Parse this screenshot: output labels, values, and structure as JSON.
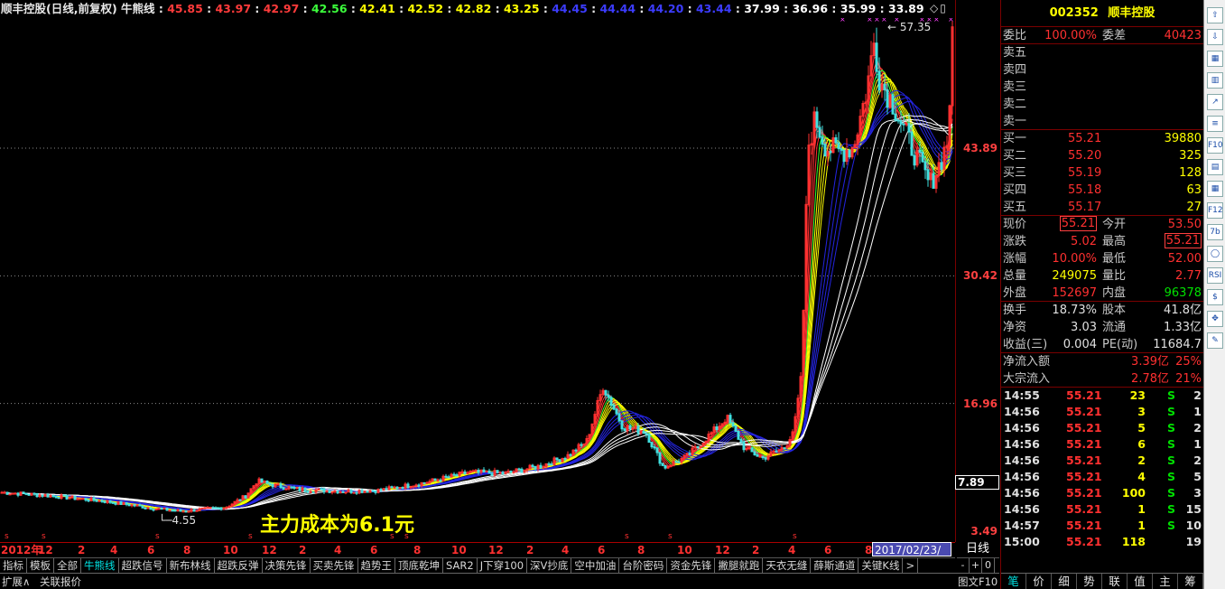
{
  "title": {
    "name": "顺丰控股(日线,前复权) 牛熊线",
    "values": [
      {
        "v": "45.85",
        "c": "#ff3b3b"
      },
      {
        "v": "43.97",
        "c": "#ff3b3b"
      },
      {
        "v": "42.97",
        "c": "#ff3b3b"
      },
      {
        "v": "42.56",
        "c": "#3cff3c"
      },
      {
        "v": "42.41",
        "c": "#ffff00"
      },
      {
        "v": "42.52",
        "c": "#ffff00"
      },
      {
        "v": "42.82",
        "c": "#ffff00"
      },
      {
        "v": "43.25",
        "c": "#ffff00"
      },
      {
        "v": "44.45",
        "c": "#3c3cff"
      },
      {
        "v": "44.44",
        "c": "#3c3cff"
      },
      {
        "v": "44.20",
        "c": "#3c3cff"
      },
      {
        "v": "43.44",
        "c": "#3c3cff"
      },
      {
        "v": "37.99",
        "c": "#ffffff"
      },
      {
        "v": "36.96",
        "c": "#ffffff"
      },
      {
        "v": "35.99",
        "c": "#ffffff"
      },
      {
        "v": "33.89",
        "c": "#ffffff"
      }
    ]
  },
  "chart": {
    "y_labels": [
      "43.89",
      "30.42",
      "16.96",
      "3.49"
    ],
    "current_price_label": "7.89",
    "high_marker": "57.35",
    "low_marker": "4.55",
    "annotation": "主力成本为6.1元",
    "x_ticks": [
      "2012年",
      "12",
      "2",
      "4",
      "6",
      "8",
      "10",
      "12",
      "2",
      "4",
      "6",
      "8",
      "10",
      "12",
      "2",
      "4",
      "6",
      "8",
      "10",
      "12",
      "2",
      "4",
      "6",
      "8",
      "1"
    ],
    "cursor_date": "2017/02/23/四",
    "period": "日线"
  },
  "tabs": [
    "指标",
    "模板",
    "全部",
    "牛熊线",
    "超跌信号",
    "新布林线",
    "超跌反弹",
    "决策先锋",
    "买卖先锋",
    "趋势王",
    "顶底乾坤",
    "SAR2",
    "J下穿100",
    "深V抄底",
    "空中加油",
    "台阶密码",
    "资金先锋",
    "撇腿就跑",
    "天衣无缝",
    "薛斯通道",
    "关键K线",
    ">"
  ],
  "active_tab": "牛熊线",
  "tab_nav": [
    "-",
    "+",
    "0"
  ],
  "status": {
    "expand": "扩展∧",
    "quote": "关联报价",
    "figure": "图文F10"
  },
  "quote": {
    "code": "002352",
    "name": "顺丰控股",
    "weibi_label": "委比",
    "weibi": "100.00%",
    "weicha_label": "委差",
    "weicha": "40423",
    "asks": [
      {
        "label": "卖五"
      },
      {
        "label": "卖四"
      },
      {
        "label": "卖三"
      },
      {
        "label": "卖二"
      },
      {
        "label": "卖一"
      }
    ],
    "bids": [
      {
        "label": "买一",
        "price": "55.21",
        "vol": "39880"
      },
      {
        "label": "买二",
        "price": "55.20",
        "vol": "325"
      },
      {
        "label": "买三",
        "price": "55.19",
        "vol": "128"
      },
      {
        "label": "买四",
        "price": "55.18",
        "vol": "63"
      },
      {
        "label": "买五",
        "price": "55.17",
        "vol": "27"
      }
    ],
    "stats": [
      {
        "l1": "现价",
        "v1": "55.21",
        "l2": "今开",
        "v2": "53.50",
        "c1": "red",
        "c2": "red",
        "box1": true
      },
      {
        "l1": "涨跌",
        "v1": "5.02",
        "l2": "最高",
        "v2": "55.21",
        "c1": "red",
        "c2": "red",
        "box2": true
      },
      {
        "l1": "涨幅",
        "v1": "10.00%",
        "l2": "最低",
        "v2": "52.00",
        "c1": "red",
        "c2": "red"
      },
      {
        "l1": "总量",
        "v1": "249075",
        "l2": "量比",
        "v2": "2.77",
        "c1": "yellow",
        "c2": "red"
      },
      {
        "l1": "外盘",
        "v1": "152697",
        "l2": "内盘",
        "v2": "96378",
        "c1": "red",
        "c2": "green"
      }
    ],
    "info": [
      {
        "l1": "换手",
        "v1": "18.73%",
        "l2": "股本",
        "v2": "41.8亿"
      },
      {
        "l1": "净资",
        "v1": "3.03",
        "l2": "流通",
        "v2": "1.33亿"
      },
      {
        "l1": "收益(三)",
        "v1": "0.004",
        "l2": "PE(动)",
        "v2": "11684.7"
      }
    ],
    "flows": [
      {
        "label": "净流入额",
        "v1": "3.39亿",
        "v2": "25%"
      },
      {
        "label": "大宗流入",
        "v1": "2.78亿",
        "v2": "21%"
      }
    ],
    "ticks": [
      {
        "t": "14:55",
        "p": "55.21",
        "v": "23",
        "s": "S",
        "n": "2"
      },
      {
        "t": "14:56",
        "p": "55.21",
        "v": "3",
        "s": "S",
        "n": "1"
      },
      {
        "t": "14:56",
        "p": "55.21",
        "v": "5",
        "s": "S",
        "n": "2"
      },
      {
        "t": "14:56",
        "p": "55.21",
        "v": "6",
        "s": "S",
        "n": "1"
      },
      {
        "t": "14:56",
        "p": "55.21",
        "v": "2",
        "s": "S",
        "n": "2"
      },
      {
        "t": "14:56",
        "p": "55.21",
        "v": "4",
        "s": "S",
        "n": "5"
      },
      {
        "t": "14:56",
        "p": "55.21",
        "v": "100",
        "s": "S",
        "n": "3"
      },
      {
        "t": "14:56",
        "p": "55.21",
        "v": "1",
        "s": "S",
        "n": "15"
      },
      {
        "t": "14:57",
        "p": "55.21",
        "v": "1",
        "s": "S",
        "n": "10"
      },
      {
        "t": "15:00",
        "p": "55.21",
        "v": "118",
        "s": "",
        "n": "19"
      }
    ],
    "bottom_tabs": [
      "笔",
      "价",
      "细",
      "势",
      "联",
      "值",
      "主",
      "筹"
    ]
  },
  "toolbar_icons": [
    "arrow-up-icon",
    "arrow-down-icon",
    "chart-grid-icon",
    "candlestick-icon",
    "line-chart-icon",
    "k-line-icon",
    "f10-icon",
    "f8-icon",
    "table-icon",
    "f12-icon",
    "f7-icon",
    "circle-icon",
    "rss-icon",
    "money-icon",
    "move-icon",
    "pencil-icon"
  ],
  "toolbar_labels": [
    "",
    "",
    "",
    "",
    "",
    "",
    "F10",
    "",
    "",
    "F12",
    "7b",
    "",
    "RSI",
    "$",
    "",
    ""
  ]
}
